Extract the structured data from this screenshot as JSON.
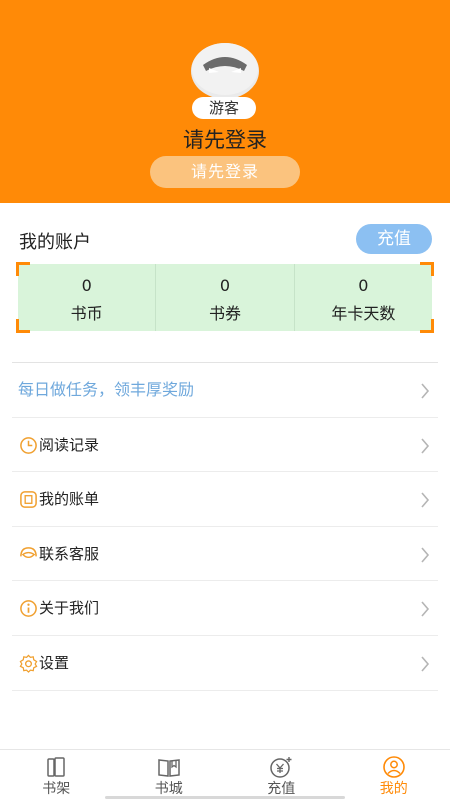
{
  "header": {
    "guest_badge": "游客",
    "login_title": "请先登录",
    "login_button": "请先登录",
    "bg_color": "#FF8A07"
  },
  "account": {
    "title": "我的账户",
    "recharge_button": "充值",
    "stats": [
      {
        "value": "0",
        "label": "书币"
      },
      {
        "value": "0",
        "label": "书券"
      },
      {
        "value": "0",
        "label": "年卡天数"
      }
    ]
  },
  "menu": [
    {
      "label": "每日做任务，领丰厚奖励",
      "icon": ""
    },
    {
      "label": "阅读记录",
      "icon": "clock-icon"
    },
    {
      "label": "我的账单",
      "icon": "bill-icon"
    },
    {
      "label": "联系客服",
      "icon": "headset-icon"
    },
    {
      "label": "关于我们",
      "icon": "info-icon"
    },
    {
      "label": "设置",
      "icon": "gear-icon"
    }
  ],
  "nav": [
    {
      "label": "书架",
      "icon": "bookshelf-icon",
      "active": false
    },
    {
      "label": "书城",
      "icon": "book-icon",
      "active": false
    },
    {
      "label": "充值",
      "icon": "coin-icon",
      "active": false
    },
    {
      "label": "我的",
      "icon": "user-icon",
      "active": true
    }
  ],
  "colors": {
    "accent": "#FF8A07",
    "recharge": "#8CC0F2",
    "stats_bg": "#D9F4DA",
    "task_text": "#6FA8DC"
  }
}
